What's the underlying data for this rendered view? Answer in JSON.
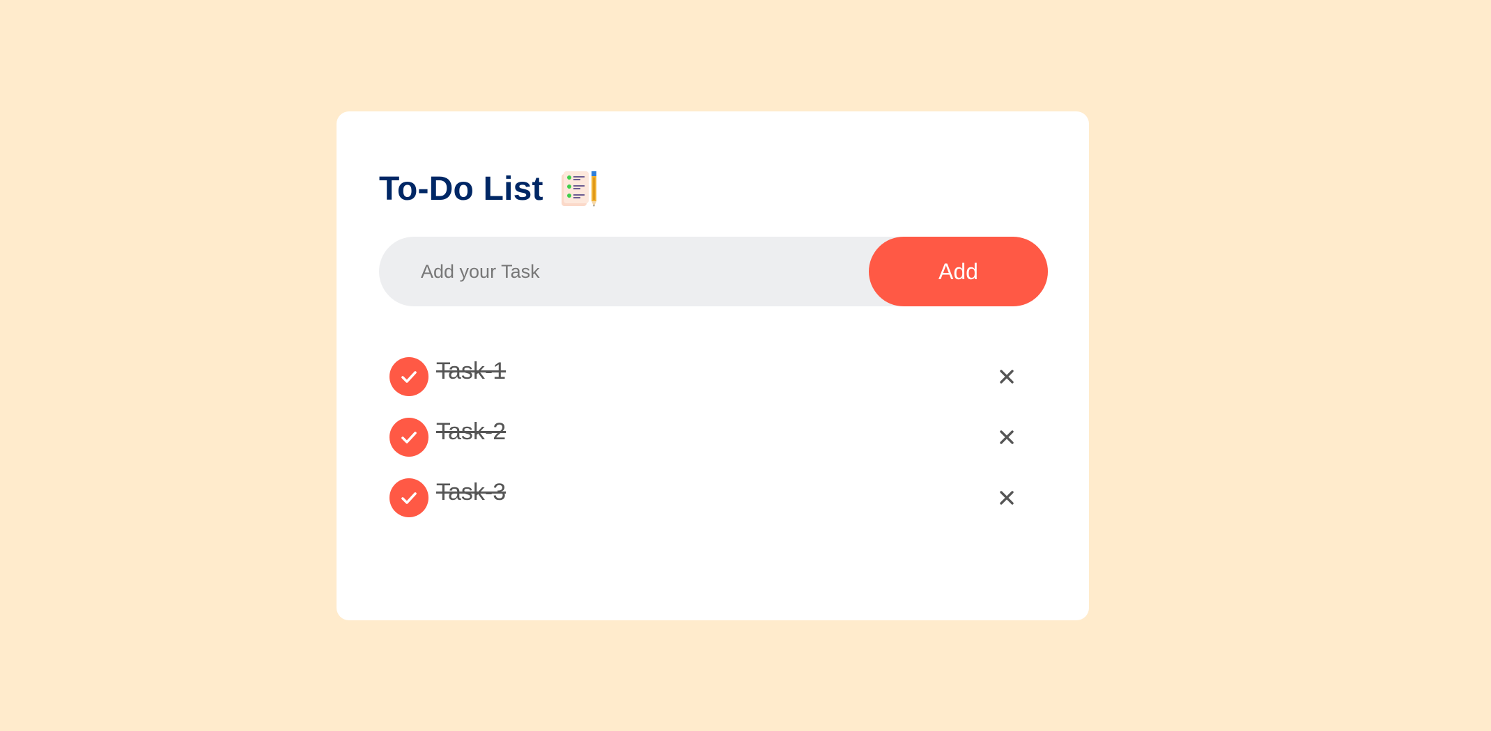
{
  "app": {
    "title": "To-Do List",
    "title_icon": "notepad-checklist-pencil-icon"
  },
  "input": {
    "placeholder": "Add your Task",
    "value": ""
  },
  "add_button": {
    "label": "Add"
  },
  "tasks": [
    {
      "label": "Task-1",
      "checked": true
    },
    {
      "label": "Task-2",
      "checked": true
    },
    {
      "label": "Task-3",
      "checked": true
    }
  ],
  "colors": {
    "background": "#ffebcc",
    "card": "#ffffff",
    "accent": "#ff5945",
    "title": "#002765",
    "input_bg": "#edeef0",
    "task_text": "#555555"
  },
  "icons": {
    "check": "check-icon",
    "delete": "close-icon"
  }
}
